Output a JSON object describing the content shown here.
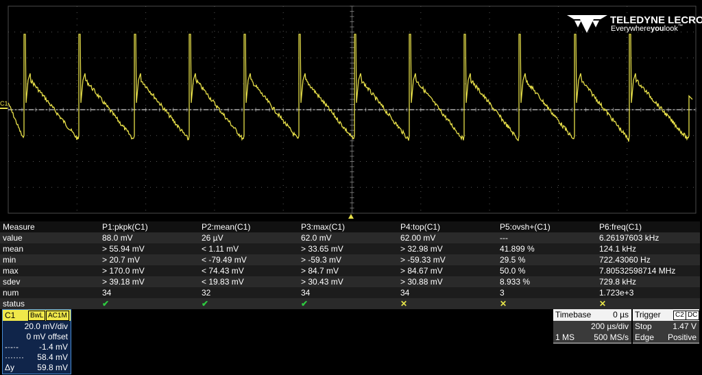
{
  "brand": {
    "name": "TELEDYNE LECROY",
    "tagline_pre": "Everywhere",
    "tagline_you": "you",
    "tagline_post": "look",
    "tm": "™"
  },
  "channel_marker": "C1",
  "colors": {
    "trace": "#e8e04a",
    "grid": "#5a5a5a",
    "ok": "#2ecc40"
  },
  "measure": {
    "headers": [
      "Measure",
      "P1:pkpk(C1)",
      "P2:mean(C1)",
      "P3:max(C1)",
      "P4:top(C1)",
      "P5:ovsh+(C1)",
      "P6:freq(C1)"
    ],
    "rows": [
      [
        "value",
        "88.0 mV",
        "26 µV",
        "62.0 mV",
        "62.00 mV",
        "---",
        "6.26197603 kHz"
      ],
      [
        "mean",
        "> 55.94 mV",
        "< 1.11 mV",
        "> 33.65 mV",
        "> 32.98 mV",
        "41.899 %",
        "124.1 kHz"
      ],
      [
        "min",
        "> 20.7 mV",
        "< -79.49 mV",
        "> -59.3 mV",
        "> -59.33 mV",
        "29.5 %",
        "722.43060 Hz"
      ],
      [
        "max",
        "> 170.0 mV",
        "< 74.43 mV",
        "> 84.7 mV",
        "> 84.67 mV",
        "50.0 %",
        "7.80532598714 MHz"
      ],
      [
        "sdev",
        "> 39.18 mV",
        "< 19.83 mV",
        "> 30.43 mV",
        "> 30.88 mV",
        "8.933 %",
        "729.8 kHz"
      ],
      [
        "num",
        "34",
        "32",
        "34",
        "34",
        "3",
        "1.723e+3"
      ]
    ],
    "status_label": "status",
    "status": [
      "ok",
      "ok",
      "ok",
      "warn",
      "warn",
      "warn"
    ],
    "status_glyph_ok": "✔",
    "status_glyph_warn": "✕"
  },
  "ch1": {
    "name": "C1",
    "bwl": "BwL",
    "coupling": "AC1M",
    "vdiv": "20.0 mV/div",
    "offset": "0 mV offset",
    "cursor1_label": "-·-·-",
    "cursor1_val": "-1.4 mV",
    "cursor2_label": "·······",
    "cursor2_val": "58.4 mV",
    "delta_label": "Δy",
    "delta_val": "59.8 mV"
  },
  "timebase": {
    "title": "Timebase",
    "delay": "0 µs",
    "tdiv": "200 µs/div",
    "mem": "1 MS",
    "rate": "500 MS/s"
  },
  "trigger": {
    "title": "Trigger",
    "src_tag": "C2",
    "coup_tag": "DC",
    "mode": "Stop",
    "level": "1.47 V",
    "type": "Edge",
    "slope": "Positive"
  }
}
